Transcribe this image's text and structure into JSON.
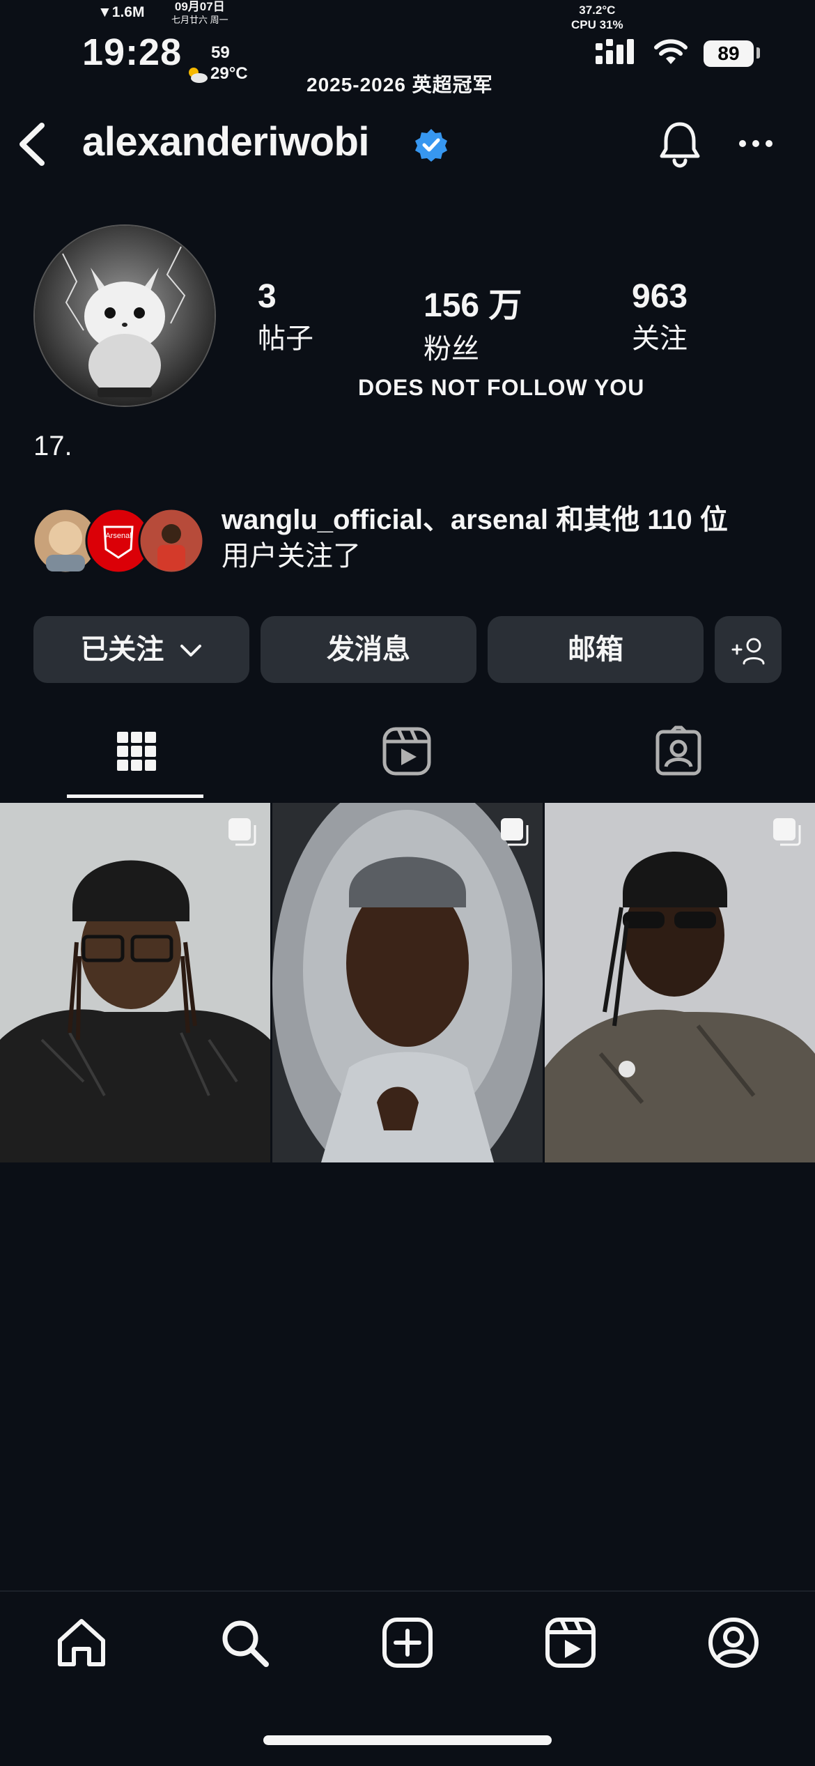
{
  "status_bar": {
    "network_speed": "▼1.6M",
    "date": "09月07日",
    "lunar": "七月廿六 周一",
    "time": "19:28",
    "aqi": "59",
    "weather": "29°C",
    "banner": "2025-2026 英超冠军",
    "temperature": "37.2°C",
    "cpu": "CPU 31%",
    "battery": "89"
  },
  "header": {
    "username": "alexanderiwobi",
    "icons": [
      "back-icon",
      "verified-badge-icon",
      "bell-icon",
      "more-icon"
    ]
  },
  "profile": {
    "stats": [
      {
        "value": "3",
        "label": "帖子"
      },
      {
        "value": "156 万",
        "label": "粉丝"
      },
      {
        "value": "963",
        "label": "关注"
      }
    ],
    "follow_status": "DOES NOT FOLLOW YOU",
    "bio": "17.",
    "mutual_line1": "wanglu_official、arsenal 和其他 110 位",
    "mutual_line2": "用户关注了",
    "mutual_avatar_badge": "Arsenal"
  },
  "actions": {
    "following": "已关注",
    "message": "发消息",
    "email": "邮箱"
  },
  "tabs": [
    {
      "name": "grid",
      "icon": "grid-icon",
      "active": true
    },
    {
      "name": "reels",
      "icon": "reels-icon",
      "active": false
    },
    {
      "name": "tagged",
      "icon": "tagged-icon",
      "active": false
    }
  ],
  "posts": [
    {
      "icon": "carousel-icon"
    },
    {
      "icon": "carousel-icon"
    },
    {
      "icon": "carousel-icon"
    }
  ],
  "nav": [
    "home-icon",
    "search-icon",
    "create-icon",
    "reels-icon",
    "profile-icon"
  ],
  "colors": {
    "background": "#0b0f16",
    "button": "#2a2f36",
    "verified": "#3797f0",
    "arsenal_red": "#db0007"
  }
}
